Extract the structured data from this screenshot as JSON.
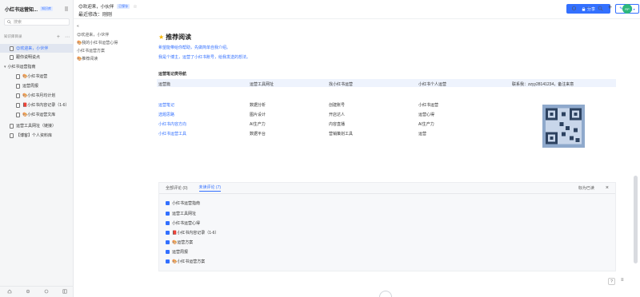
{
  "sidebar": {
    "space_title": "小红书运营知...",
    "space_badge": "知识库",
    "search_placeholder": "搜索",
    "section_label": "知识库目录",
    "items": [
      {
        "label": "😊欢迎来，小伙伴",
        "active": true
      },
      {
        "label": "跟你说明说点"
      },
      {
        "label": "小红书运营指南"
      },
      {
        "label": "🎨小红书运营"
      },
      {
        "label": "运营周报"
      },
      {
        "label": "🎨小红书月均计划"
      },
      {
        "label": "📕小红书内容记录（1-6）"
      },
      {
        "label": "🎨小红书运营文库"
      },
      {
        "label": "运营工具网址（链接）"
      },
      {
        "label": "【博客】个人资料库"
      }
    ],
    "footer_icons": [
      "home-icon",
      "settings-icon",
      "sync-icon",
      "layout-icon"
    ]
  },
  "topbar": {
    "title": "😊欢迎来，小伙伴",
    "status_badge": "已保存",
    "meta": "最近修改：刚刚",
    "share_label": "分享",
    "edit_label": "编辑"
  },
  "outline": {
    "collapse": "«",
    "items": [
      "😊欢迎来，小伙伴",
      "🎨我的小红书运营心得",
      "小红书运营方案",
      "🎨推荐阅读"
    ]
  },
  "main": {
    "heading": "推荐阅读",
    "intro_line1": "希望能带给你帮助，先做简单自我介绍。",
    "intro_line2": "我是个博主，运营了小红书账号，给我发送的想法。",
    "table_title": "运营笔记类导航",
    "columns": [
      "运营篇",
      "运营工具网址",
      "找小红书运营",
      "小红书个人运营"
    ],
    "contact": "联系我：zzyy28141234，备注来意",
    "rows": [
      [
        "运营笔记",
        "数据分析",
        "创建账号",
        "小红书运营"
      ],
      [
        "选题思路",
        "图片设计",
        "开店达人",
        "运营心得"
      ],
      [
        "小红书内容方向",
        "AI生产力",
        "内容直播",
        "AI生产力"
      ],
      [
        "小红书运营工具",
        "数据平台",
        "营销策划工具",
        "运营"
      ]
    ]
  },
  "panel": {
    "tab_1": "全部评论 (0)",
    "tab_2": "未读评论 (7)",
    "action": "标为已读",
    "items": [
      "小红书运营指南",
      "运营工具网址",
      "小红书运营心得",
      "📕小红书内容记录（1-6）",
      "🎨运营方案",
      "运营周报",
      "🎨小红书运营方案"
    ]
  },
  "colors": {
    "accent": "#3370ff",
    "sidebar_bg": "#f5f6f7",
    "panel_bg": "#f7f8fa",
    "avatar": "#2db87d"
  }
}
